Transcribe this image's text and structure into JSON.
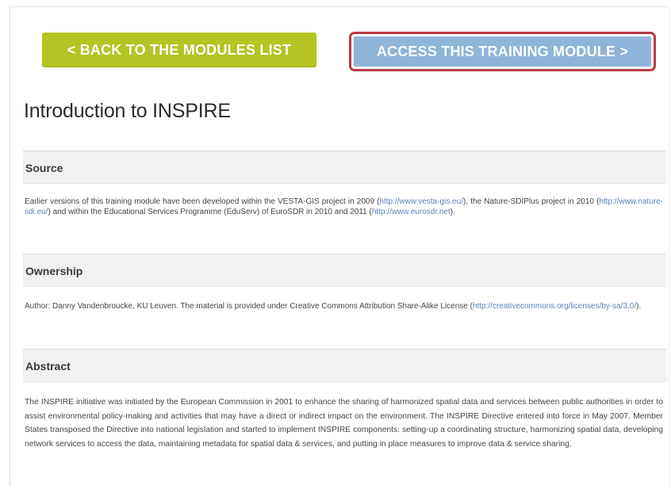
{
  "buttons": {
    "back_label": "< BACK TO THE MODULES LIST",
    "access_label": "ACCESS THIS TRAINING MODULE >"
  },
  "page": {
    "title": "Introduction to INSPIRE"
  },
  "sections": {
    "source": {
      "heading": "Source",
      "text_1": "Earlier versions of this training module have been developed within the VESTA-GIS project in 2009 (",
      "link_1": "http://www.vesta-gis.eu/",
      "text_2": "), the Nature-SDIPlus project in 2010 (",
      "link_2": "http://www.nature-sdi.eu/",
      "text_3": ") and within the Educational Services Programme (EduServ) of EuroSDR in 2010 and 2011 (",
      "link_3": "http://www.eurosdr.net",
      "text_4": ")."
    },
    "ownership": {
      "heading": "Ownership",
      "text_1": "Author: Danny Vandenbroucke, KU Leuven. The material is provided under Creative Commons Attribution Share-Alike License (",
      "link_1": "http://creativecommons.org/licenses/by-sa/3.0/",
      "text_2": ")."
    },
    "abstract": {
      "heading": "Abstract",
      "text": "The INSPIRE initiative was initiated by the European Commission in 2001 to enhance the sharing of harmonized spatial data and services between public authorities in order to assist environmental policy-making and activities that may have a direct or indirect impact on the environment. The INSPIRE Directive entered into force in May 2007. Member States transposed the Directive into national legislation and started to implement INSPIRE components: setting-up a coordinating structure, harmonizing spatial data, developing network services to access the data, maintaining metadata for spatial data & services, and putting in place measures to improve data & service sharing."
    }
  }
}
